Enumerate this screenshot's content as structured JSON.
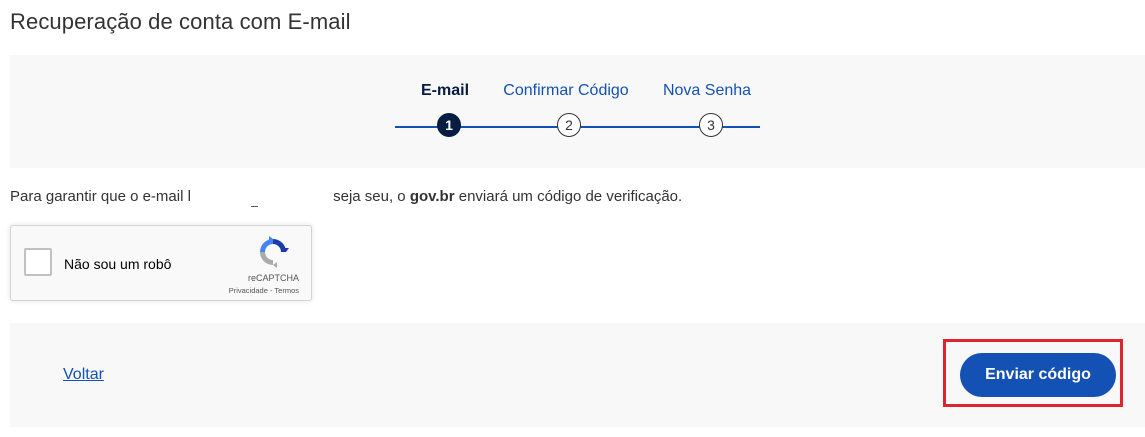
{
  "page": {
    "title": "Recuperação de conta com E-mail"
  },
  "stepper": {
    "steps": [
      {
        "label": "E-mail",
        "number": "1",
        "state": "active"
      },
      {
        "label": "Confirmar Código",
        "number": "2",
        "state": "pending"
      },
      {
        "label": "Nova Senha",
        "number": "3",
        "state": "pending"
      }
    ],
    "line_color": "#1351b4",
    "active_color": "#071d41"
  },
  "info": {
    "prefix": "Para garantir que o e-mail ",
    "partial_email": "l",
    "middle": " seja seu, o ",
    "brand": "gov.br",
    "suffix": " enviará um código de verificação."
  },
  "recaptcha": {
    "label": "Não sou um robô",
    "brand": "reCAPTCHA",
    "links": "Privacidade - Termos",
    "logo_icon": "recaptcha-icon"
  },
  "footer": {
    "back_label": "Voltar",
    "send_label": "Enviar código",
    "primary_color": "#1351b4",
    "highlight_color": "#e0242b"
  }
}
